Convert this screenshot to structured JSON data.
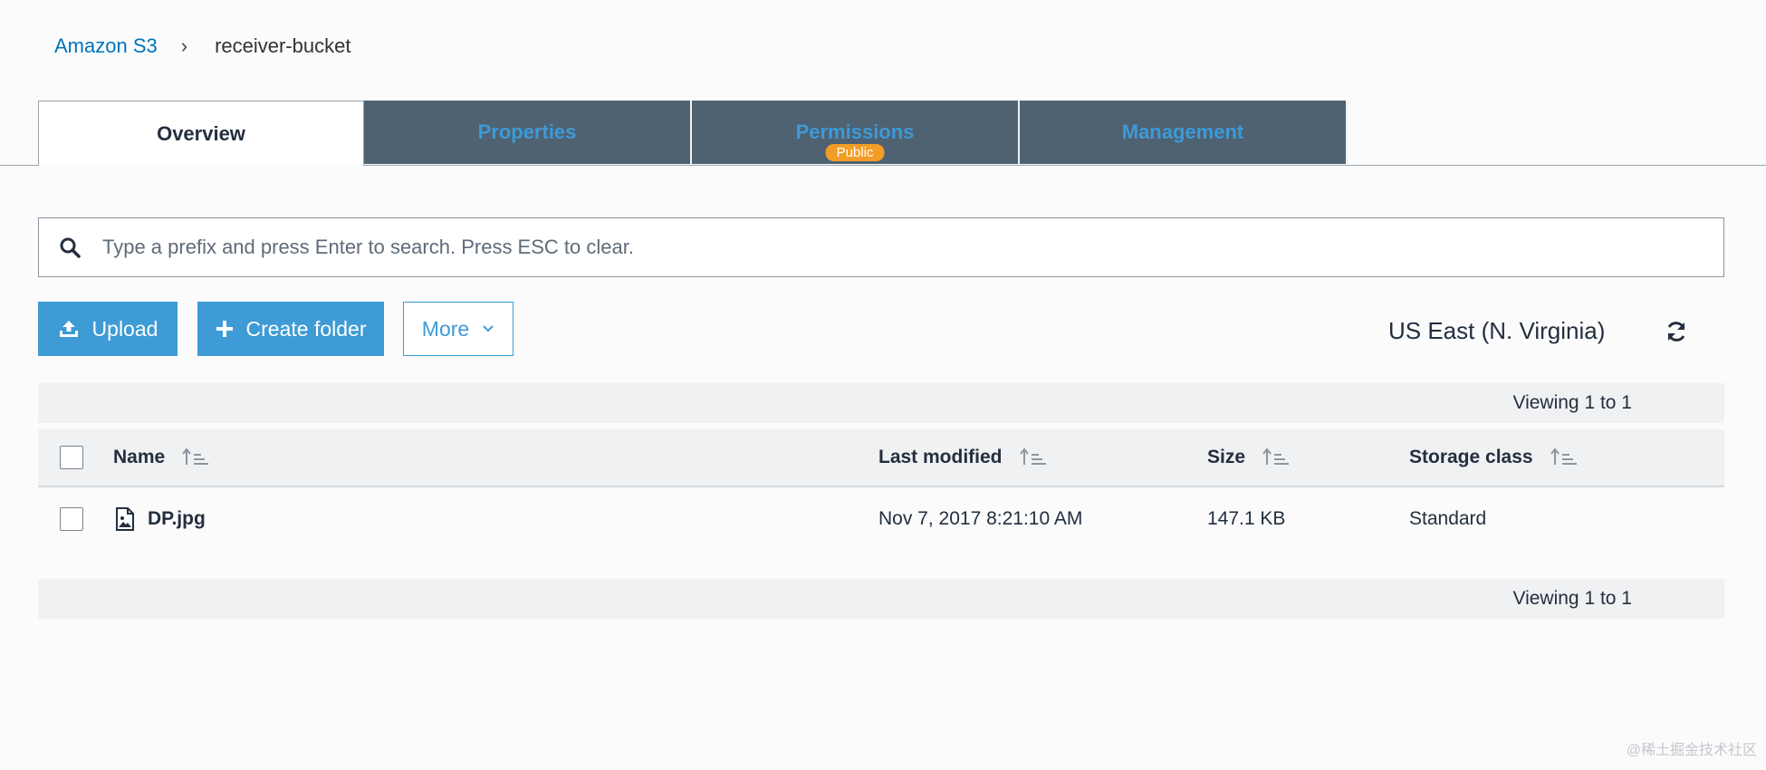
{
  "breadcrumb": {
    "root": "Amazon S3",
    "separator": "›",
    "current": "receiver-bucket"
  },
  "tabs": [
    {
      "label": "Overview",
      "active": true
    },
    {
      "label": "Properties",
      "active": false
    },
    {
      "label": "Permissions",
      "active": false,
      "badge": "Public"
    },
    {
      "label": "Management",
      "active": false
    }
  ],
  "search": {
    "placeholder": "Type a prefix and press Enter to search. Press ESC to clear.",
    "value": ""
  },
  "toolbar": {
    "upload_label": "Upload",
    "create_folder_label": "Create folder",
    "more_label": "More",
    "region": "US East (N. Virginia)"
  },
  "table": {
    "viewing_top": "Viewing 1 to 1",
    "viewing_bottom": "Viewing 1 to 1",
    "columns": [
      "Name",
      "Last modified",
      "Size",
      "Storage class"
    ],
    "rows": [
      {
        "name": "DP.jpg",
        "last_modified": "Nov 7, 2017 8:21:10 AM",
        "size": "147.1 KB",
        "storage_class": "Standard"
      }
    ]
  },
  "watermark": "@稀土掘金技术社区",
  "colors": {
    "accent": "#3e9bd6",
    "tab_inactive_bg": "#4f6272",
    "badge": "#f29d26"
  },
  "icons": [
    "search-icon",
    "upload-icon",
    "plus-icon",
    "chevron-down-icon",
    "refresh-icon",
    "sort-icon",
    "image-file-icon"
  ]
}
